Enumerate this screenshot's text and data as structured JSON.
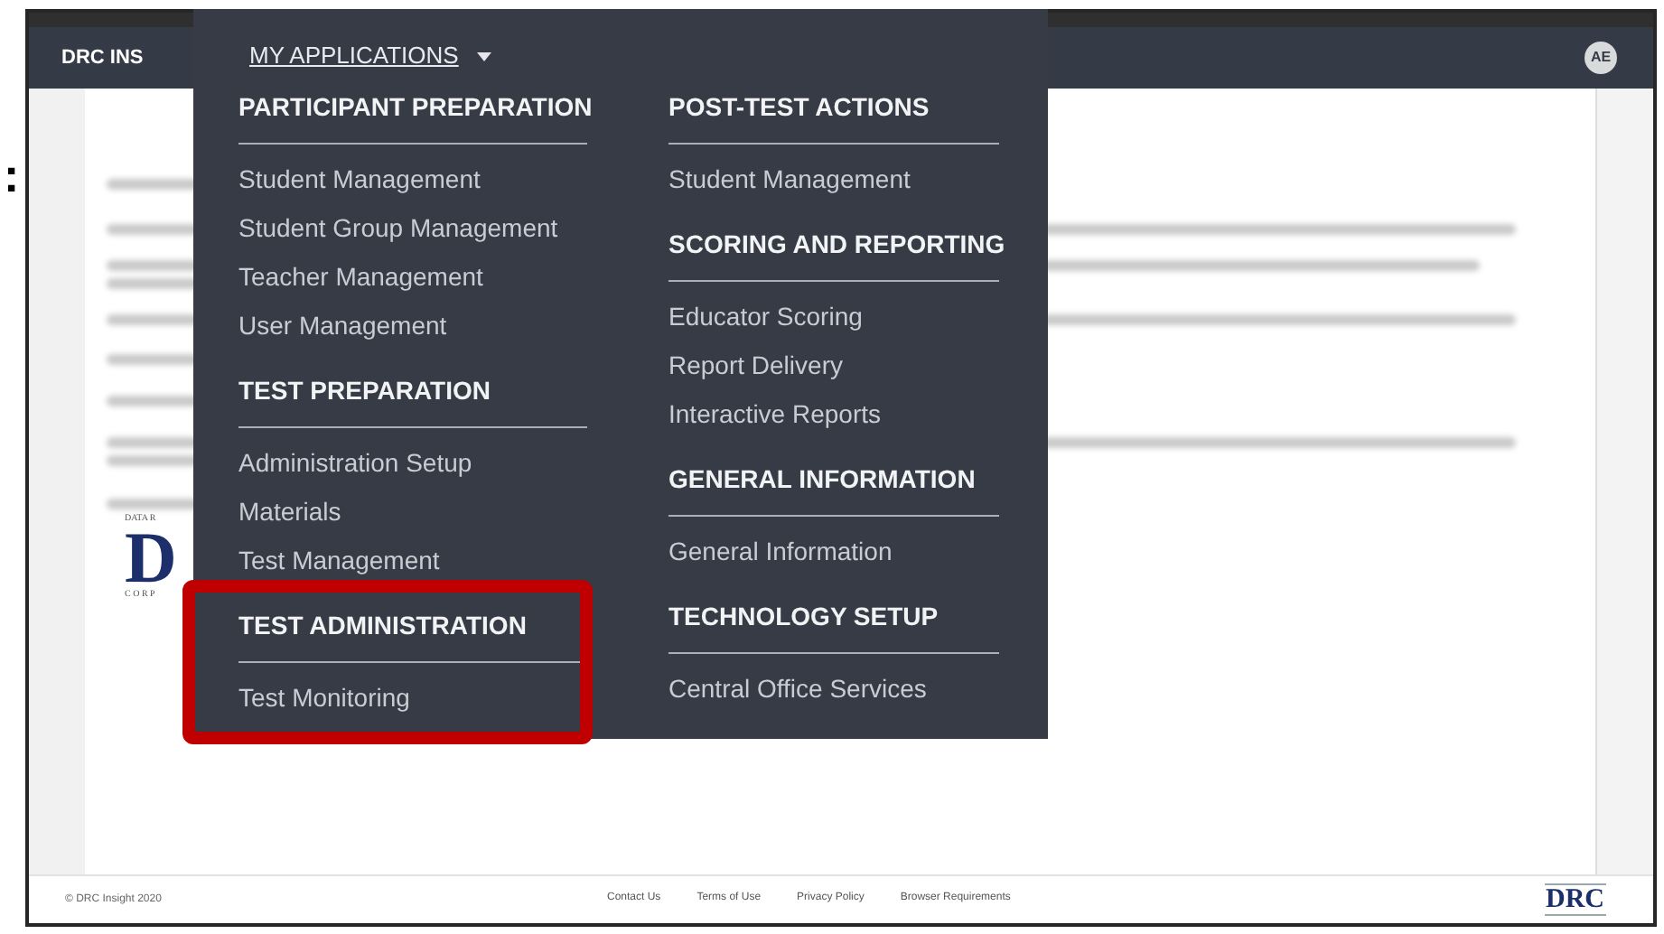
{
  "side_mark": ":",
  "app_bar": {
    "logo_text": "DRC INS",
    "menu_label": "MY APPLICATIONS",
    "avatar": "AE"
  },
  "menu_columns": [
    [
      {
        "title": "PARTICIPANT PREPARATION",
        "highlighted": false,
        "items": [
          "Student Management",
          "Student Group Management",
          "Teacher Management",
          "User Management"
        ]
      },
      {
        "title": "TEST PREPARATION",
        "highlighted": false,
        "items": [
          "Administration Setup",
          "Materials",
          "Test Management"
        ]
      },
      {
        "title": "TEST ADMINISTRATION",
        "highlighted": true,
        "items": [
          "Test Monitoring"
        ]
      }
    ],
    [
      {
        "title": "POST-TEST ACTIONS",
        "highlighted": false,
        "items": [
          "Student Management"
        ]
      },
      {
        "title": "SCORING AND REPORTING",
        "highlighted": false,
        "items": [
          "Educator Scoring",
          "Report Delivery",
          "Interactive Reports"
        ]
      },
      {
        "title": "GENERAL INFORMATION",
        "highlighted": false,
        "items": [
          "General Information"
        ]
      },
      {
        "title": "TECHNOLOGY SETUP",
        "highlighted": false,
        "items": [
          "Central Office Services"
        ]
      }
    ]
  ],
  "page_logo": {
    "top": "DATA R",
    "letter": "D",
    "bottom": "C O R P"
  },
  "footer": {
    "copyright": "© DRC Insight 2020",
    "links": [
      "Contact Us",
      "Terms of Use",
      "Privacy Policy",
      "Browser Requirements"
    ],
    "logo": "DRC"
  }
}
